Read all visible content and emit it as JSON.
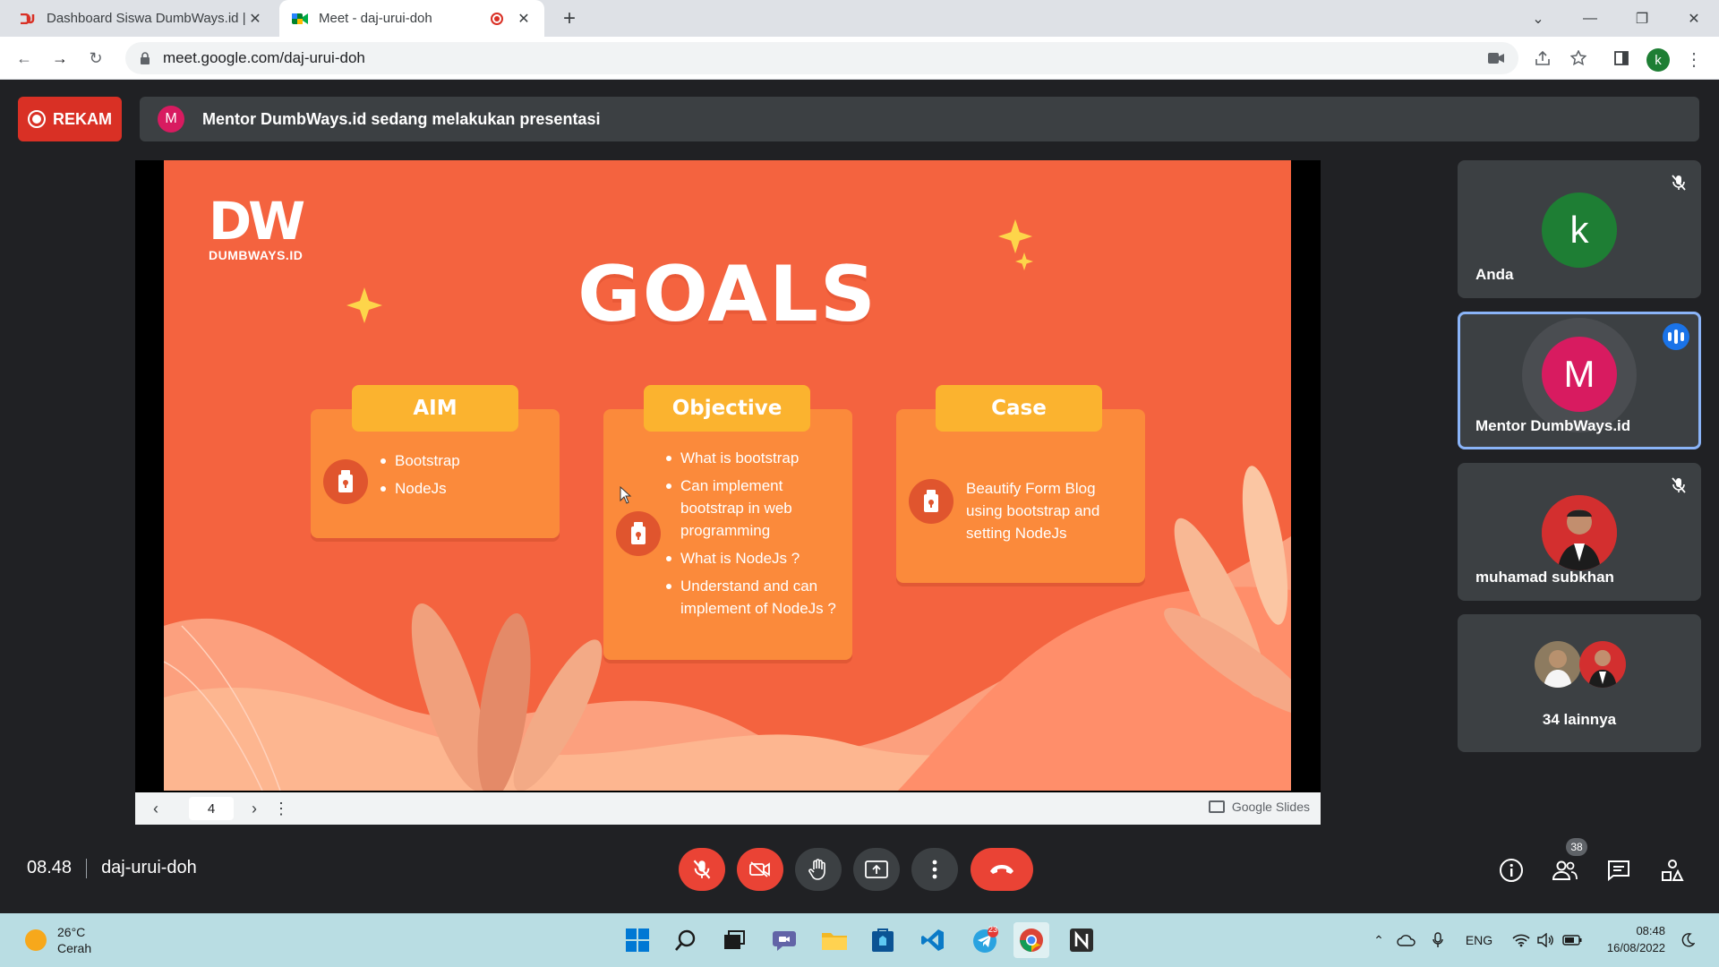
{
  "browser": {
    "tabs": [
      {
        "title": "Dashboard Siswa DumbWays.id |",
        "active": false
      },
      {
        "title": "Meet - daj-urui-doh",
        "active": true
      }
    ],
    "url": "meet.google.com/daj-urui-doh",
    "profile_initial": "k"
  },
  "meet": {
    "record_label": "REKAM",
    "banner_initial": "M",
    "banner_text": "Mentor DumbWays.id sedang melakukan presentasi",
    "time": "08.48",
    "meeting_code": "daj-urui-doh",
    "participant_count": "38"
  },
  "slide": {
    "logo_mark": "DW",
    "logo_word": "DUMBWAYS.ID",
    "title": "GOALS",
    "cards": {
      "aim": {
        "title": "AIM",
        "items": [
          "Bootstrap",
          "NodeJs"
        ]
      },
      "objective": {
        "title": "Objective",
        "items": [
          "What is bootstrap",
          "Can implement bootstrap in web programming",
          "What is NodeJs ?",
          "Understand and can implement of NodeJs ?"
        ]
      },
      "case": {
        "title": "Case",
        "text": "Beautify Form Blog using bootstrap and setting NodeJs"
      }
    },
    "page_number": "4",
    "app_label": "Google Slides"
  },
  "participants": [
    {
      "name": "Anda",
      "initial": "k",
      "color": "#1e7e34",
      "muted": true
    },
    {
      "name": "Mentor DumbWays.id",
      "initial": "M",
      "color": "#d81b60",
      "speaking": true
    },
    {
      "name": "muhamad subkhan",
      "muted": true
    }
  ],
  "others_label": "34 lainnya",
  "taskbar": {
    "temperature": "26°C",
    "weather": "Cerah",
    "language": "ENG",
    "clock_time": "08:48",
    "clock_date": "16/08/2022",
    "telegram_badge": "23"
  }
}
